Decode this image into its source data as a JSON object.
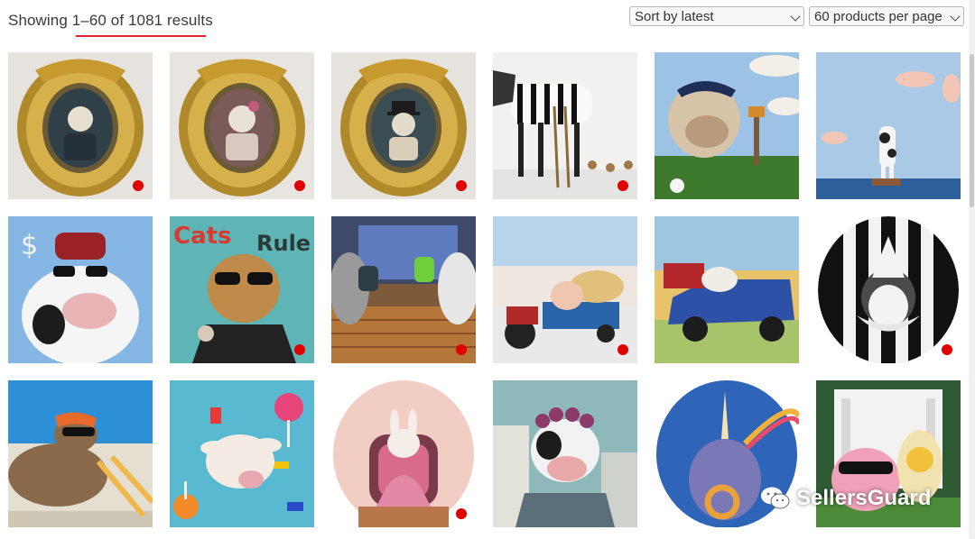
{
  "toolbar": {
    "results_text": "Showing 1–60 of 1081 results",
    "sort": {
      "selected": "Sort by latest"
    },
    "per_page": {
      "selected": "60 products per page"
    }
  },
  "products": [
    {
      "subject": "framed-portrait-bird-officer",
      "badge": true
    },
    {
      "subject": "framed-portrait-bird-lady",
      "badge": true
    },
    {
      "subject": "framed-portrait-bird-top-hat",
      "badge": true
    },
    {
      "subject": "zebra-painting-ladder-meerkats",
      "badge": true
    },
    {
      "subject": "bulldog-golfer",
      "badge": false
    },
    {
      "subject": "diving-cow-sea",
      "badge": false
    },
    {
      "subject": "cow-sunglasses-money",
      "badge": false
    },
    {
      "subject": "cat-sunglasses-graffiti",
      "badge": true
    },
    {
      "subject": "cats-pickleball",
      "badge": true
    },
    {
      "subject": "pig-tractor-hay",
      "badge": true
    },
    {
      "subject": "dog-blue-truck",
      "badge": false
    },
    {
      "subject": "penguin-clown-oval",
      "badge": true
    },
    {
      "subject": "seal-beach-chair",
      "badge": false
    },
    {
      "subject": "goat-candy",
      "badge": false
    },
    {
      "subject": "bunny-pink-chair-oval",
      "badge": true
    },
    {
      "subject": "cow-curlers-kitchen",
      "badge": false
    },
    {
      "subject": "narwhal-rainbow-oval",
      "badge": false
    },
    {
      "subject": "pig-duck-wedding",
      "badge": false
    }
  ],
  "watermark": {
    "text": "SellersGuard"
  },
  "colors": {
    "badge": "#e00000",
    "underline": "#e0242a"
  }
}
